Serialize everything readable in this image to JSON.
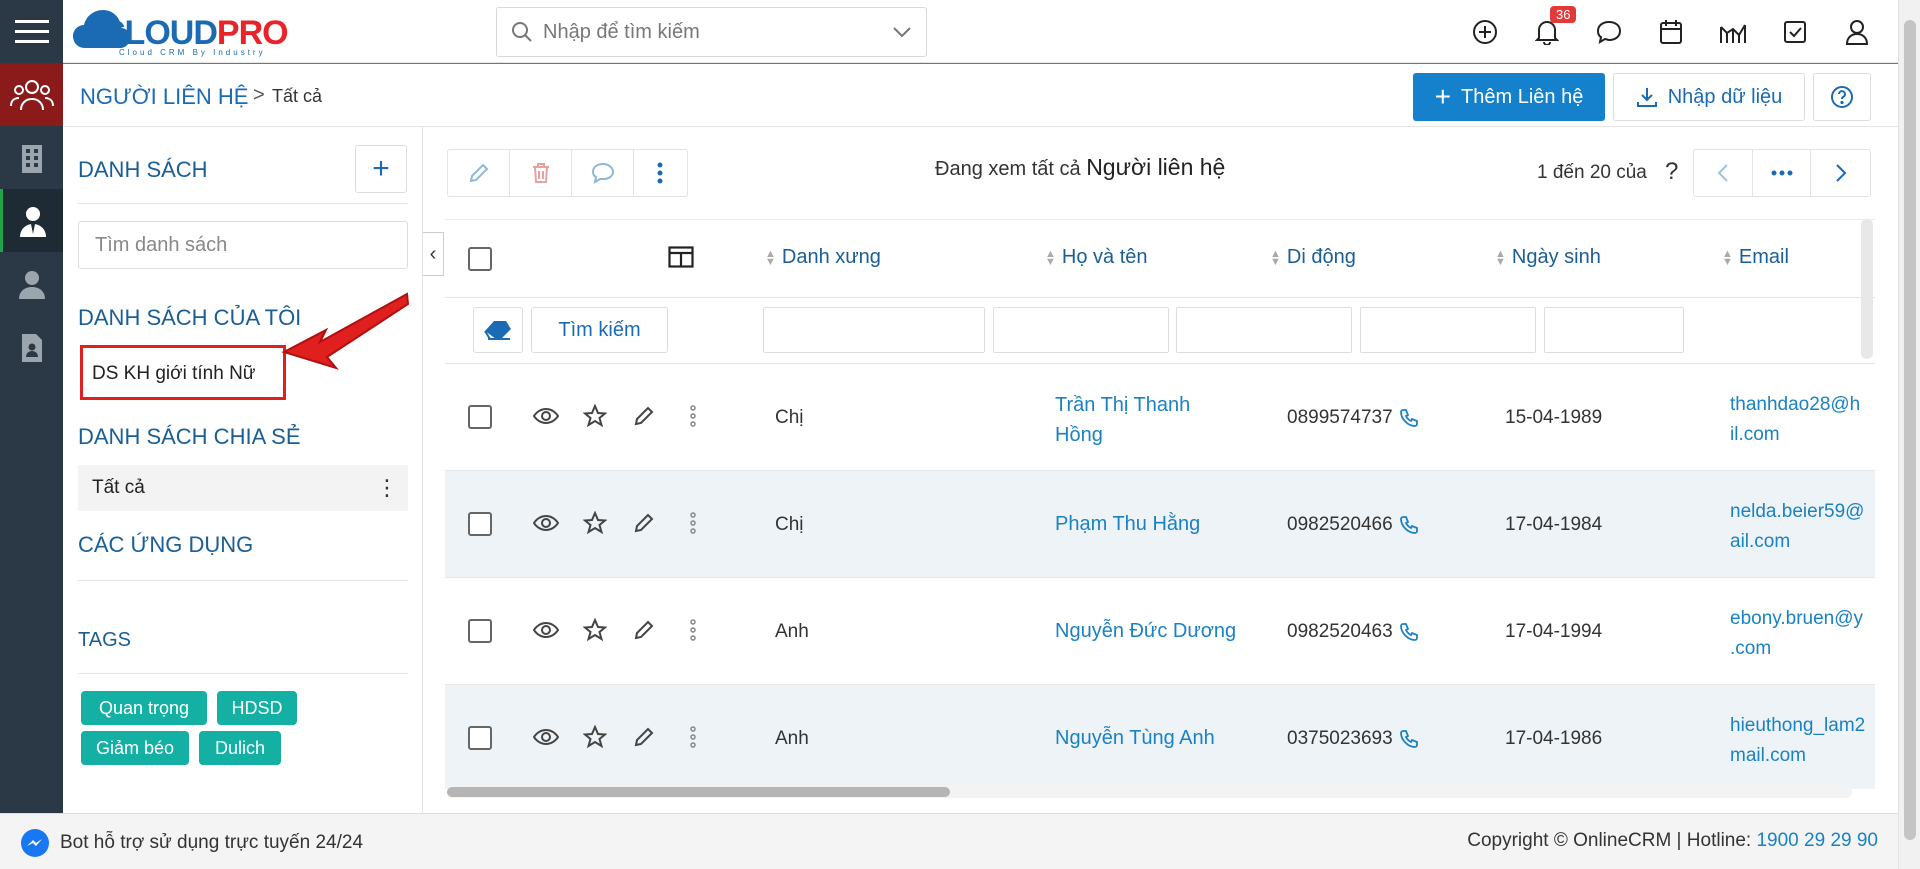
{
  "app": {
    "logo_text_main": "CLOUD",
    "logo_text_accent": "PRO",
    "logo_tagline": "Cloud CRM By Industry"
  },
  "topbar": {
    "search_placeholder": "Nhập để tìm kiếm",
    "notification_count": "36"
  },
  "header": {
    "module_title": "NGƯỜI LIÊN HỆ",
    "separator": ">",
    "current_view": "Tất cả",
    "add_button": "Thêm Liên hệ",
    "import_button": "Nhập dữ liệu"
  },
  "sidebar": {
    "lists_title": "DANH SÁCH",
    "search_placeholder": "Tìm danh sách",
    "my_lists_title": "DANH SÁCH CỦA TÔI",
    "my_lists": [
      "DS KH giới tính Nữ"
    ],
    "shared_lists_title": "DANH SÁCH CHIA SẺ",
    "shared_lists": [
      "Tất cả"
    ],
    "apps_title": "CÁC ỨNG DỤNG",
    "tags_title": "TAGS",
    "tags": [
      "Quan trọng",
      "HDSD",
      "Giảm béo",
      "Dulich"
    ]
  },
  "main": {
    "viewing_prefix": "Đang xem tất cả",
    "viewing_module": "Người liên hệ",
    "page_range": "1 đến 20 của",
    "page_unknown": "?",
    "search_button": "Tìm kiếm"
  },
  "table": {
    "columns": [
      "Danh xưng",
      "Họ và tên",
      "Di động",
      "Ngày sinh",
      "Email"
    ],
    "rows": [
      {
        "salutation": "Chị",
        "name_line1": "Trần Thị Thanh",
        "name_line2": "Hồng",
        "mobile": "0899574737",
        "birthday": "15-04-1989",
        "email_line1": "thanhdao28@h",
        "email_line2": "il.com"
      },
      {
        "salutation": "Chị",
        "name_line1": "Phạm Thu Hằng",
        "name_line2": "",
        "mobile": "0982520466",
        "birthday": "17-04-1984",
        "email_line1": "nelda.beier59@",
        "email_line2": "ail.com"
      },
      {
        "salutation": "Anh",
        "name_line1": "Nguyễn Đức Dương",
        "name_line2": "",
        "mobile": "0982520463",
        "birthday": "17-04-1994",
        "email_line1": "ebony.bruen@y",
        "email_line2": ".com"
      },
      {
        "salutation": "Anh",
        "name_line1": "Nguyễn Tùng Anh",
        "name_line2": "",
        "mobile": "0375023693",
        "birthday": "17-04-1986",
        "email_line1": "hieuthong_lam2",
        "email_line2": "mail.com"
      }
    ]
  },
  "footer": {
    "bot_text": "Bot hỗ trợ sử dụng trực tuyến 24/24",
    "copyright": "Copyright © OnlineCRM | Hotline:",
    "hotline": "1900 29 29 90"
  },
  "colors": {
    "brand_blue": "#1580cc",
    "link_blue": "#1a82c4",
    "rail_bg": "#2a3945",
    "tag_teal": "#13b0a3",
    "highlight_red": "#e01f1f"
  }
}
